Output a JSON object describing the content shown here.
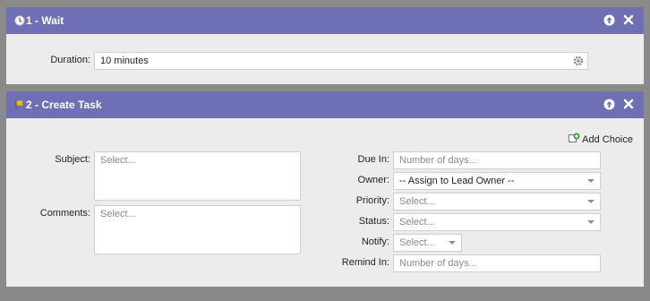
{
  "wait_panel": {
    "title": "1 - Wait",
    "duration_label": "Duration:",
    "duration_value": "10 minutes"
  },
  "task_panel": {
    "title": "2 - Create Task",
    "add_choice_label": "Add Choice",
    "subject_label": "Subject:",
    "subject_placeholder": "Select...",
    "comments_label": "Comments:",
    "comments_placeholder": "Select...",
    "due_in_label": "Due In:",
    "due_in_placeholder": "Number of days...",
    "owner_label": "Owner:",
    "owner_value": "-- Assign to Lead Owner --",
    "priority_label": "Priority:",
    "priority_placeholder": "Select...",
    "status_label": "Status:",
    "status_placeholder": "Select...",
    "notify_label": "Notify:",
    "notify_placeholder": "Select...",
    "remind_in_label": "Remind In:",
    "remind_in_placeholder": "Number of days..."
  },
  "colors": {
    "header": "#6f6fb6",
    "panel_bg": "#ececec",
    "page_bg": "#8a8a8a"
  }
}
